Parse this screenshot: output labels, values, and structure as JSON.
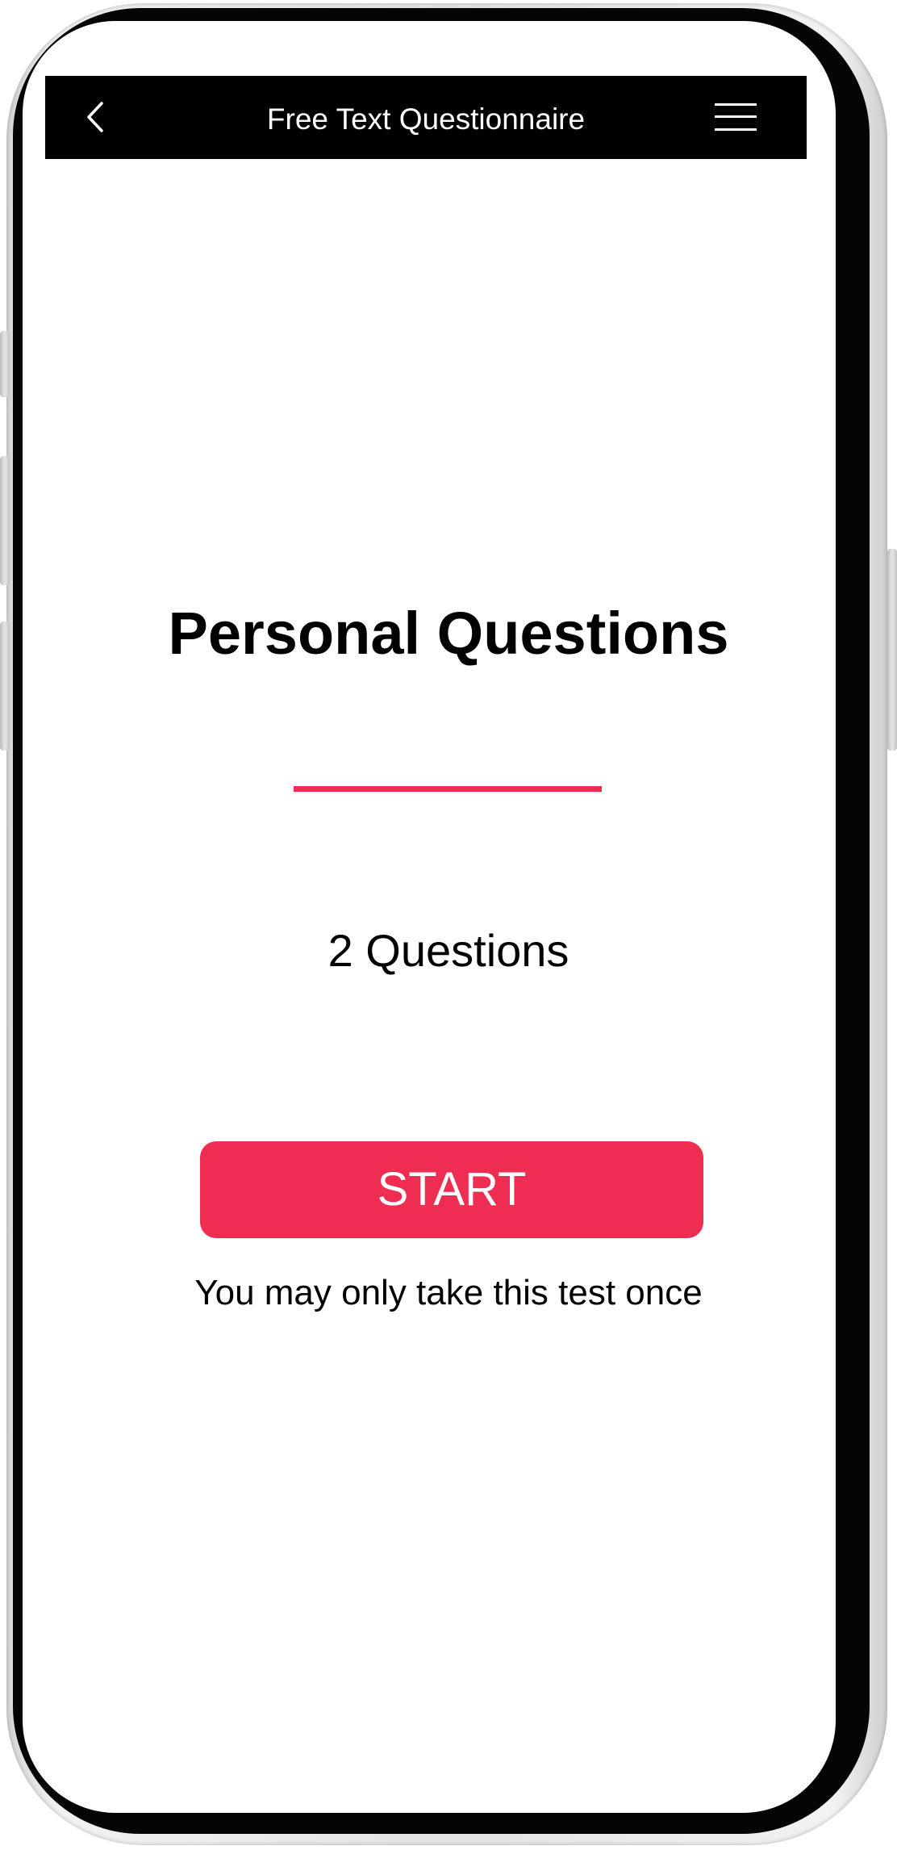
{
  "header": {
    "title": "Free Text Questionnaire",
    "back_icon": "chevron-left-icon",
    "menu_icon": "hamburger-menu-icon"
  },
  "main": {
    "title": "Personal Questions",
    "question_count": "2 Questions",
    "start_label": "START",
    "note": "You may only take this test once"
  },
  "colors": {
    "accent": "#ef2d52",
    "header_bg": "#000000",
    "text": "#000000"
  }
}
